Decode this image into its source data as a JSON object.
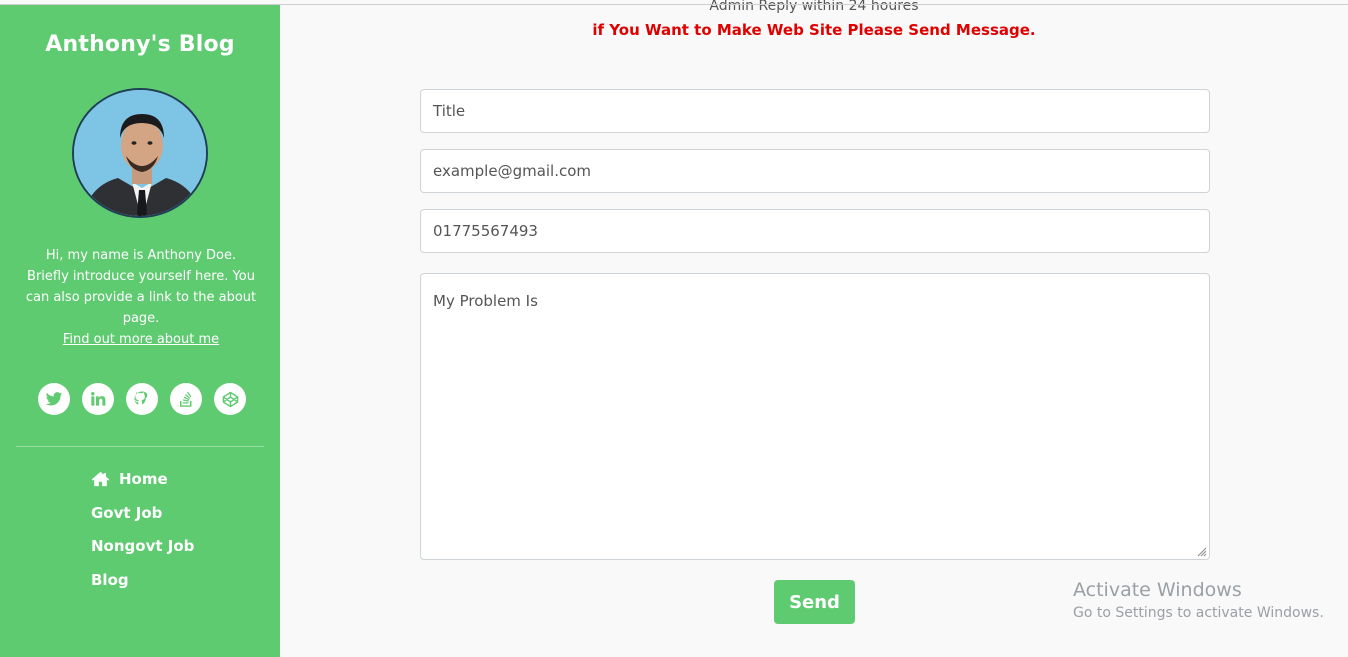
{
  "sidebar": {
    "title": "Anthony's Blog",
    "bio": "Hi, my name is Anthony Doe. Briefly introduce yourself here. You can also provide a link to the about page.",
    "about_link": "Find out more about me",
    "social_icons": [
      "twitter-icon",
      "linkedin-icon",
      "github-icon",
      "stackoverflow-icon",
      "codepen-icon"
    ],
    "nav": [
      {
        "label": "Home",
        "icon": "home-icon"
      },
      {
        "label": "Govt Job"
      },
      {
        "label": "Nongovt Job"
      },
      {
        "label": "Blog"
      }
    ]
  },
  "main": {
    "reply_text": "Admin Reply within 24 houres",
    "notice": "if You Want to Make Web Site Please Send Message.",
    "form": {
      "title_placeholder": "Title",
      "email_placeholder": "example@gmail.com",
      "phone_placeholder": "01775567493",
      "message_placeholder": "My Problem Is",
      "send_label": "Send"
    }
  },
  "watermark": {
    "title": "Activate Windows",
    "subtitle": "Go to Settings to activate Windows."
  },
  "colors": {
    "accent": "#5fcb71",
    "notice": "#e00000"
  }
}
